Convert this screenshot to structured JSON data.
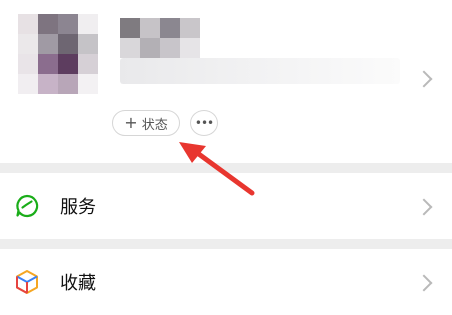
{
  "profile": {
    "status_button": {
      "label": "状态",
      "icon": "plus-icon"
    },
    "more_button": {
      "label": "•••",
      "icon": "more-icon"
    }
  },
  "menu": {
    "items": [
      {
        "label": "服务",
        "icon": "services-icon"
      },
      {
        "label": "收藏",
        "icon": "favorites-icon"
      }
    ]
  },
  "annotation": {
    "arrow_color": "#e8362f"
  },
  "colors": {
    "services_green": "#1aad19",
    "fav_orange": "#f5a623",
    "fav_blue": "#3b82f6",
    "fav_red": "#e64340",
    "divider": "#ededed"
  }
}
